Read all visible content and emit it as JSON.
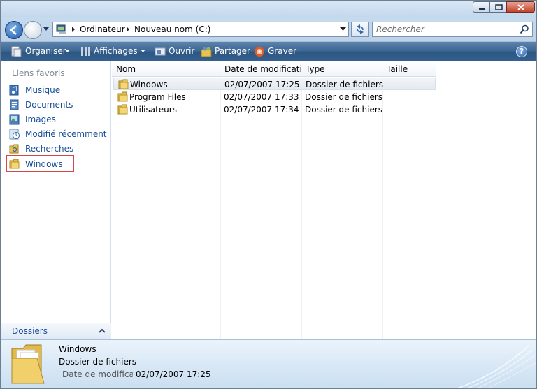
{
  "window": {
    "caption_buttons": [
      "minimize",
      "maximize",
      "close"
    ]
  },
  "address": {
    "crumbs": [
      "Ordinateur",
      "Nouveau nom (C:)"
    ]
  },
  "search": {
    "placeholder": "Rechercher"
  },
  "toolbar": {
    "organiser": "Organiser",
    "affichages": "Affichages",
    "ouvrir": "Ouvrir",
    "partager": "Partager",
    "graver": "Graver",
    "help": "?"
  },
  "nav": {
    "title": "Liens favoris",
    "items": [
      {
        "label": "Musique",
        "icon": "music-icon"
      },
      {
        "label": "Documents",
        "icon": "documents-icon"
      },
      {
        "label": "Images",
        "icon": "images-icon"
      },
      {
        "label": "Modifié récemment",
        "icon": "recent-icon"
      },
      {
        "label": "Recherches",
        "icon": "search-folder-icon"
      },
      {
        "label": "Windows",
        "icon": "folder-icon",
        "selected": true
      }
    ],
    "folders_label": "Dossiers"
  },
  "files": {
    "columns": [
      "Nom",
      "Date de modificati...",
      "Type",
      "Taille"
    ],
    "rows": [
      {
        "name": "Windows",
        "date": "02/07/2007 17:25",
        "type": "Dossier de fichiers",
        "size": "",
        "selected": true
      },
      {
        "name": "Program Files",
        "date": "02/07/2007 17:33",
        "type": "Dossier de fichiers",
        "size": ""
      },
      {
        "name": "Utilisateurs",
        "date": "02/07/2007 17:34",
        "type": "Dossier de fichiers",
        "size": ""
      }
    ]
  },
  "details": {
    "name": "Windows",
    "type": "Dossier de fichiers",
    "date_label": "Date de modificati...",
    "date": "02/07/2007 17:25"
  },
  "colors": {
    "toolbar": "#35608f",
    "link": "#1a4f99",
    "selection_border": "#d4474a",
    "folder": "#e8c14f"
  }
}
